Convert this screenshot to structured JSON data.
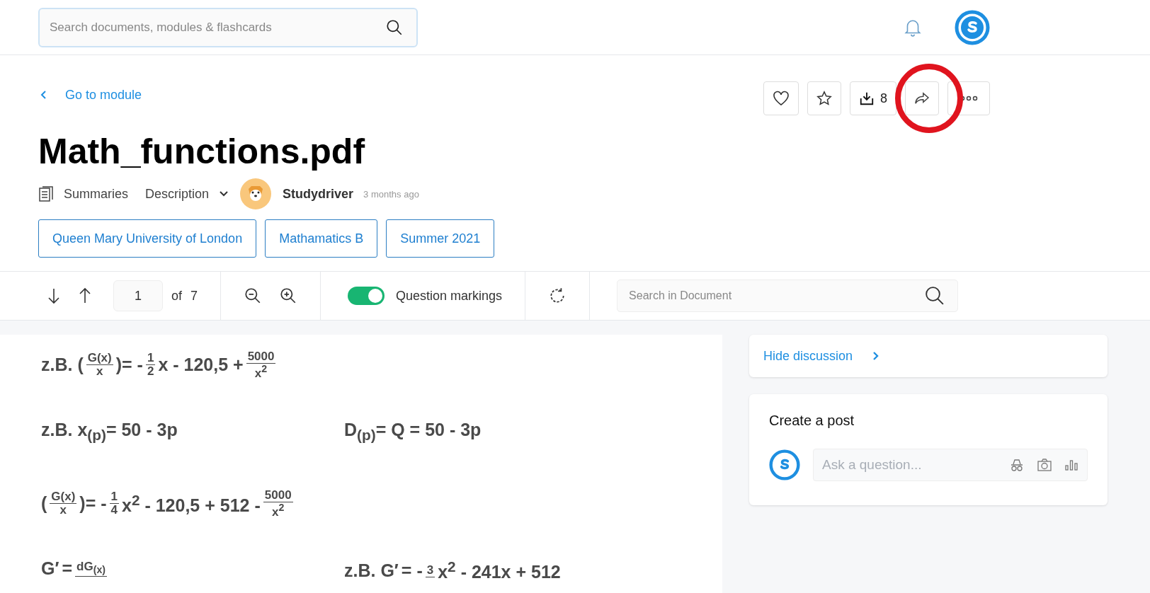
{
  "search": {
    "placeholder": "Search documents, modules & flashcards"
  },
  "back_link": {
    "label": "Go to module"
  },
  "actions": {
    "download_count": "8"
  },
  "title": "Math_functions.pdf",
  "meta": {
    "summaries": "Summaries",
    "description": "Description",
    "author": "Studydriver",
    "time": "3 months ago"
  },
  "tags": [
    "Queen Mary University of London",
    "Mathamatics B",
    "Summer 2021"
  ],
  "toolbar": {
    "page": "1",
    "page_of": "of",
    "page_total": "7",
    "question_markings": {
      "label": "Question markings",
      "on": true
    },
    "doc_search": {
      "placeholder": "Search in Document"
    }
  },
  "document": {
    "rows": [
      {
        "left": [
          {
            "kind": "text",
            "text": "z.B. ("
          },
          {
            "kind": "frac",
            "num": "G(x)",
            "den": "x"
          },
          {
            "kind": "text",
            "text": ")= -"
          },
          {
            "kind": "frac",
            "num": "1",
            "den": "2"
          },
          {
            "kind": "text",
            "text": "x - 120,5 +"
          },
          {
            "kind": "frac",
            "num": "5000",
            "den": "x$^{2}$"
          }
        ],
        "right": []
      },
      {
        "left": [
          {
            "kind": "text",
            "text": "z.B. x$_{(p)}$= 50 - 3p"
          }
        ],
        "right": [
          {
            "kind": "text",
            "text": "D$_{(p)}$= Q = 50 - 3p"
          }
        ]
      },
      {
        "left": [
          {
            "kind": "text",
            "text": "("
          },
          {
            "kind": "frac",
            "num": "G(x)",
            "den": "x"
          },
          {
            "kind": "text",
            "text": ")= -"
          },
          {
            "kind": "frac",
            "num": "1",
            "den": "4"
          },
          {
            "kind": "text",
            "text": "x$^{2}$ - 120,5 + 512 -"
          },
          {
            "kind": "frac",
            "num": "5000",
            "den": "x$^{2}$"
          }
        ],
        "right": []
      },
      {
        "left": [
          {
            "kind": "text",
            "text": "G′"
          },
          {
            "kind": "text",
            "text": "="
          },
          {
            "kind": "frac",
            "num": "dG$_{(x)}$"
          }
        ],
        "right": [
          {
            "kind": "text",
            "text": "z.B. G′"
          },
          {
            "kind": "text",
            "text": "= -"
          },
          {
            "kind": "frac",
            "num": "3"
          },
          {
            "kind": "text",
            "text": "x$^{2}$ - 241x + 512"
          }
        ]
      }
    ]
  },
  "discussion": {
    "hide_label": "Hide discussion",
    "create_post_title": "Create a post",
    "ask": {
      "placeholder": "Ask a question..."
    }
  }
}
